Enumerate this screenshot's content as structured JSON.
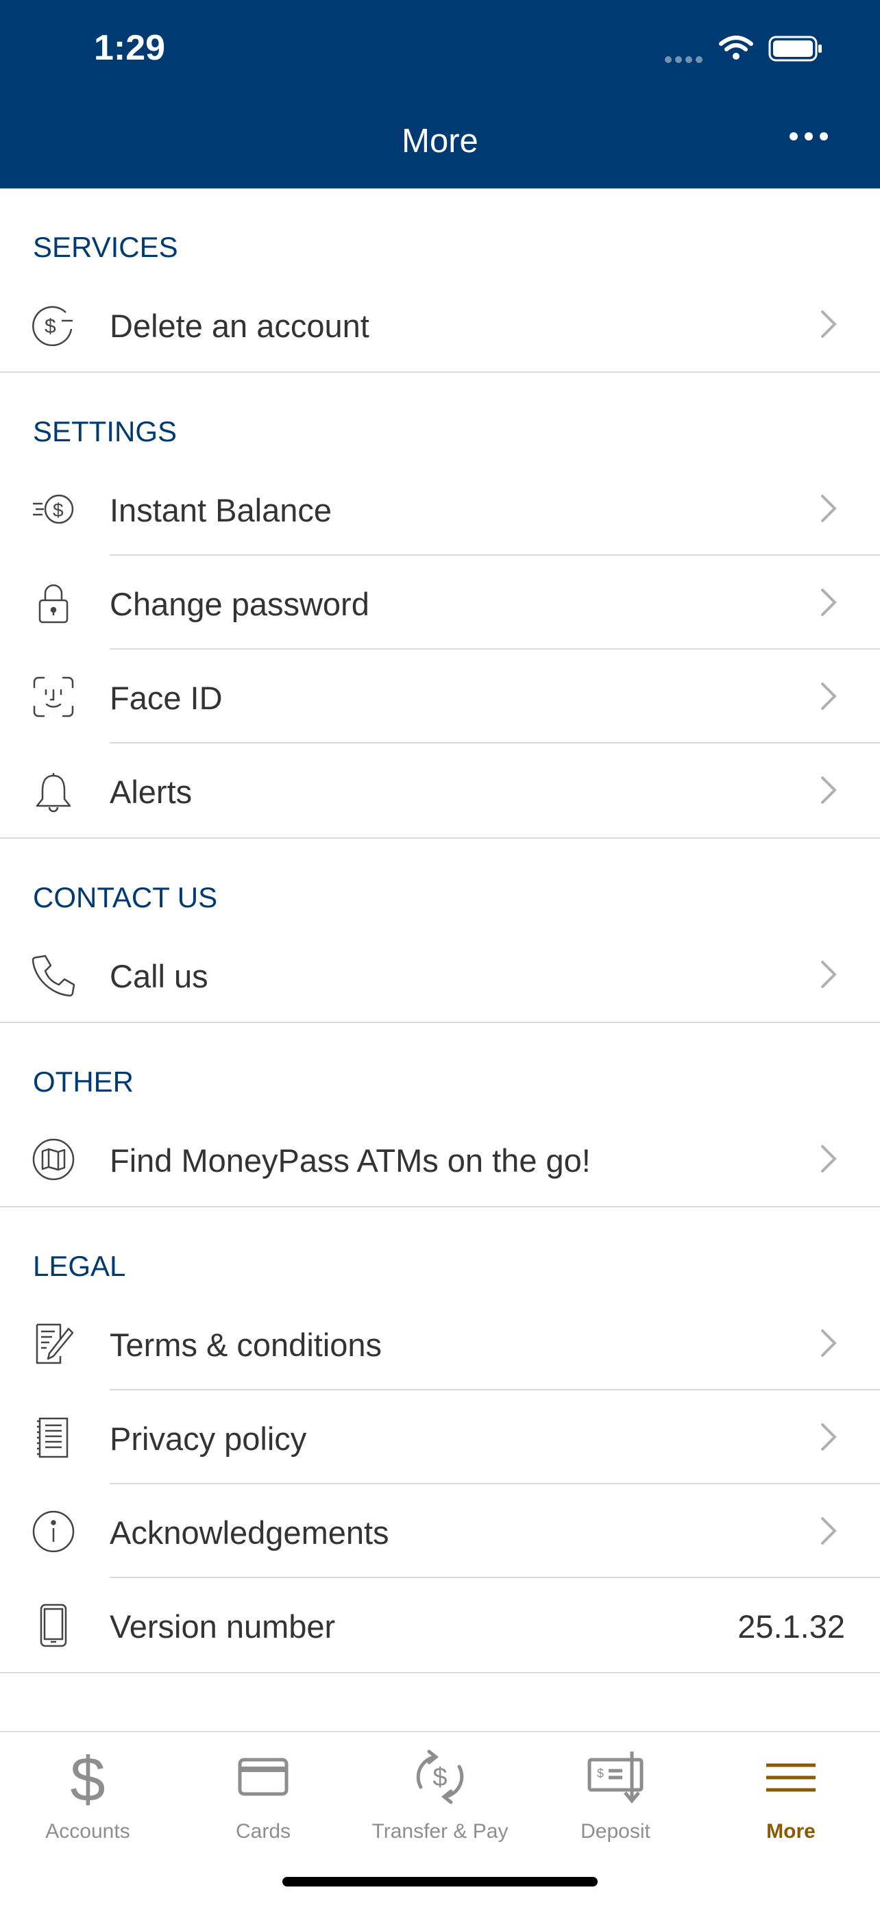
{
  "status_bar": {
    "time": "1:29"
  },
  "nav": {
    "title": "More"
  },
  "sections": {
    "services": {
      "title": "SERVICES",
      "items": [
        {
          "label": "Delete an account",
          "icon": "dollar-circle-icon"
        }
      ]
    },
    "settings": {
      "title": "SETTINGS",
      "items": [
        {
          "label": "Instant Balance",
          "icon": "fast-dollar-icon"
        },
        {
          "label": "Change password",
          "icon": "lock-icon"
        },
        {
          "label": "Face ID",
          "icon": "face-id-icon"
        },
        {
          "label": "Alerts",
          "icon": "bell-icon"
        }
      ]
    },
    "contact": {
      "title": "CONTACT US",
      "items": [
        {
          "label": "Call us",
          "icon": "phone-icon"
        }
      ]
    },
    "other": {
      "title": "OTHER",
      "items": [
        {
          "label": "Find MoneyPass ATMs on the go!",
          "icon": "map-icon"
        }
      ]
    },
    "legal": {
      "title": "LEGAL",
      "items": [
        {
          "label": "Terms & conditions",
          "icon": "document-pen-icon"
        },
        {
          "label": "Privacy policy",
          "icon": "document-icon"
        },
        {
          "label": "Acknowledgements",
          "icon": "info-icon"
        },
        {
          "label": "Version number",
          "value": "25.1.32",
          "icon": "phone-device-icon"
        }
      ]
    }
  },
  "tabbar": {
    "tabs": [
      {
        "label": "Accounts",
        "icon": "dollar-icon"
      },
      {
        "label": "Cards",
        "icon": "card-icon"
      },
      {
        "label": "Transfer & Pay",
        "icon": "transfer-icon"
      },
      {
        "label": "Deposit",
        "icon": "check-deposit-icon"
      },
      {
        "label": "More",
        "icon": "menu-icon",
        "active": true
      }
    ]
  },
  "colors": {
    "brand": "#003a72",
    "active_tab": "#8a5a00",
    "section_title": "#003a72",
    "separator": "#dcdcdc"
  }
}
